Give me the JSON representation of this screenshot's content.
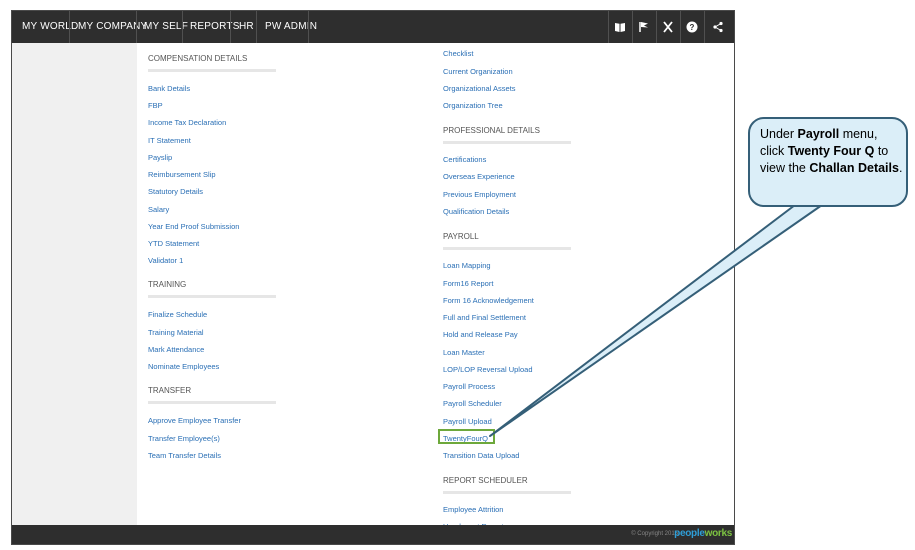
{
  "nav": {
    "items": [
      "MY WORLD",
      "MY COMPANY",
      "MY SELF",
      "REPORTS",
      "HR",
      "PW ADMIN"
    ]
  },
  "toolbar_icons": [
    "book-icon",
    "flag-icon",
    "tools-icon",
    "help-icon",
    "share-icon"
  ],
  "left_column": {
    "sections": [
      {
        "heading": "COMPENSATION DETAILS",
        "links": [
          "Bank Details",
          "FBP",
          "Income Tax Declaration",
          "IT Statement",
          "Payslip",
          "Reimbursement Slip",
          "Statutory Details",
          "Salary",
          "Year End Proof Submission",
          "YTD Statement",
          "Validator 1"
        ]
      },
      {
        "heading": "TRAINING",
        "links": [
          "Finalize Schedule",
          "Training Material",
          "Mark Attendance",
          "Nominate Employees"
        ]
      },
      {
        "heading": "TRANSFER",
        "links": [
          "Approve Employee Transfer",
          "Transfer Employee(s)",
          "Team Transfer Details"
        ]
      }
    ]
  },
  "right_column": {
    "top_links": [
      "Checklist",
      "Current Organization",
      "Organizational Assets",
      "Organization Tree"
    ],
    "sections": [
      {
        "heading": "PROFESSIONAL DETAILS",
        "links": [
          "Certifications",
          "Overseas Experience",
          "Previous Employment",
          "Qualification Details"
        ]
      },
      {
        "heading": "PAYROLL",
        "links": [
          "Loan Mapping",
          "Form16 Report",
          "Form 16 Acknowledgement",
          "Full and Final Settlement",
          "Hold and Release Pay",
          "Loan Master",
          "LOP/LOP Reversal Upload",
          "Payroll Process",
          "Payroll Scheduler",
          "Payroll Upload",
          "TwentyFourQ",
          "Transition Data Upload"
        ]
      },
      {
        "heading": "REPORT SCHEDULER",
        "links": [
          "Employee Attrition",
          "Headcount Reports"
        ]
      }
    ]
  },
  "footer": {
    "copyright": "© Copyright 2015",
    "brand_a": "people",
    "brand_b": "works"
  },
  "callout": {
    "t1": "Under ",
    "b1": "Payroll",
    "t2": " menu, click ",
    "b2": "Twenty Four Q",
    "t3": " to view the ",
    "b3": "Challan Details",
    "t4": "."
  },
  "colors": {
    "topbar": "#2e2e2e",
    "link": "#2a6fb5",
    "highlight": "#6da83b",
    "callout_fill": "#dbeef8",
    "callout_border": "#355f78"
  }
}
